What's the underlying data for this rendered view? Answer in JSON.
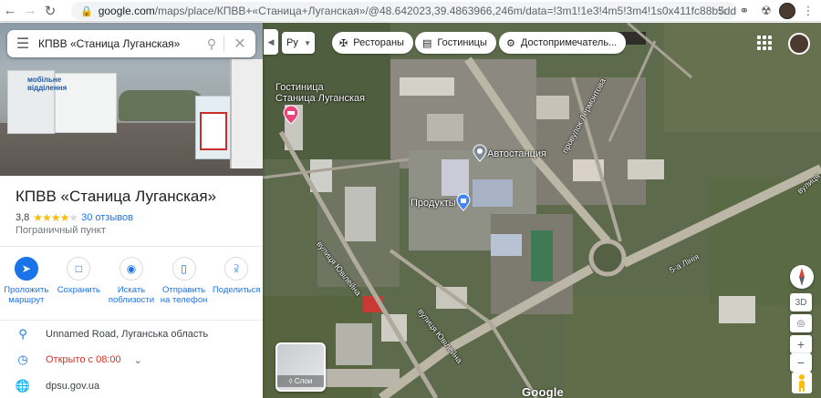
{
  "browser": {
    "url_host": "google.com",
    "url_rest": "/maps/place/КПВВ+«Станица+Луганская»/@48.642023,39.4863966,246m/data=!3m1!1e3!4m5!3m4!1s0x411fc88b5dd25177:0x31c138..."
  },
  "search": {
    "query": "КПВВ «Станица Луганская»"
  },
  "photo": {
    "sign_text": "мобільне\nвідділення"
  },
  "place": {
    "title": "КПВВ «Станица Луганская»",
    "rating": "3,8",
    "rating_value": 3.8,
    "reviews": "30 отзывов",
    "category": "Пограничный пункт"
  },
  "actions": [
    {
      "label": "Проложить маршрут",
      "icon": "directions-icon"
    },
    {
      "label": "Сохранить",
      "icon": "bookmark-icon"
    },
    {
      "label": "Искать поблизости",
      "icon": "nearby-icon"
    },
    {
      "label": "Отправить на телефон",
      "icon": "phone-icon"
    },
    {
      "label": "Поделиться",
      "icon": "share-icon"
    }
  ],
  "info": {
    "address": "Unnamed Road, Луганська область",
    "hours": "Открыто с 08:00",
    "website": "dpsu.gov.ua"
  },
  "map": {
    "lang": "Ру",
    "chips": [
      "Рестораны",
      "Гостиницы",
      "Достопримечатель..."
    ],
    "labels": {
      "hotel": "Гостиница\nСтаница Луганская",
      "bus_station": "Автостанция",
      "products": "Продукты",
      "street_yubileyna_1": "вулиця Ювілейна",
      "street_yubileyna_2": "вулиця Ювілейна",
      "street_lermontova": "провулок Лермонтова",
      "line5": "5-а Лінія",
      "street_right": "вулиця"
    },
    "layers_label": "Слои",
    "google_logo": "Google",
    "tilt": "3D"
  },
  "colors": {
    "accent": "#1a73e8",
    "star": "#fbbc04",
    "open_red": "#d93025"
  }
}
